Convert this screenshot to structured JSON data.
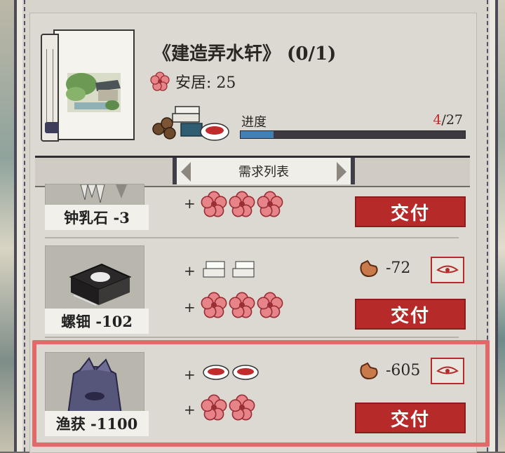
{
  "header": {
    "title": "《建造弄水轩》 (0/1)",
    "anju_label": "安居: 25",
    "progress_label": "进度",
    "progress_current": "4",
    "progress_total": "/27",
    "progress_fraction": 0.148
  },
  "list": {
    "tab_label": "需求列表",
    "items": [
      {
        "name": "钟乳石 -3",
        "plus": "+",
        "flowers": 3,
        "deliver_label": "交付"
      },
      {
        "name": "螺钿 -102",
        "plus1": "+",
        "plus2": "+",
        "slabs": 2,
        "flowers": 3,
        "cost": "-72",
        "deliver_label": "交付"
      },
      {
        "name": "渔获 -1100",
        "plus1": "+",
        "plus2": "+",
        "bowls": 2,
        "flowers": 2,
        "cost": "-605",
        "deliver_label": "交付"
      }
    ]
  },
  "colors": {
    "accent_red": "#b72a2a",
    "highlight": "#e06a6a",
    "progress_blue": "#3f7fb5"
  }
}
